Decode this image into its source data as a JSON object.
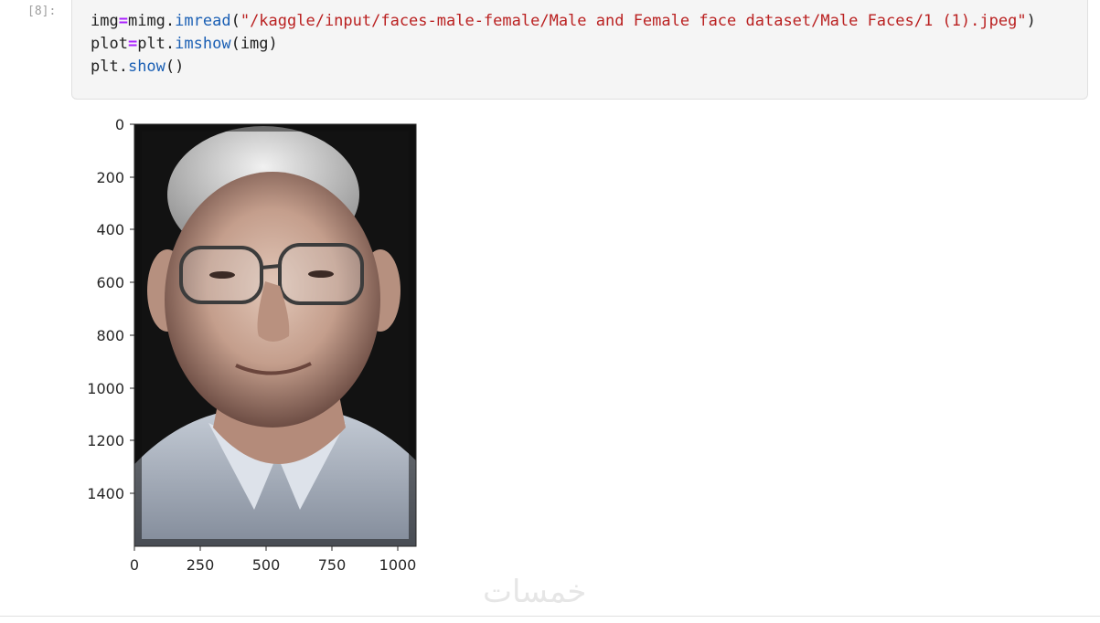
{
  "cell": {
    "prompt": "[8]:",
    "code": {
      "line1": {
        "var": "img",
        "op": "=",
        "obj": "mimg.",
        "fn": "imread",
        "open": "(",
        "str": "\"/kaggle/input/faces-male-female/Male and Female face dataset/Male Faces/1 (1).jpeg\"",
        "close": ")"
      },
      "line2": {
        "var": "plot",
        "op": "=",
        "obj": "plt.",
        "fn": "imshow",
        "args": "(img)"
      },
      "line3": {
        "obj": "plt.",
        "fn": "show",
        "args": "()"
      }
    }
  },
  "output": {
    "plot": {
      "x_ticks": [
        "0",
        "250",
        "500",
        "750",
        "1000"
      ],
      "y_ticks": [
        "0",
        "200",
        "400",
        "600",
        "800",
        "1000",
        "1200",
        "1400"
      ],
      "image_subject": "elderly-man-portrait"
    }
  },
  "chart_data": {
    "type": "image",
    "x_ticks": [
      0,
      250,
      500,
      750,
      1000
    ],
    "y_ticks": [
      0,
      200,
      400,
      600,
      800,
      1000,
      1200,
      1400
    ],
    "xlim": [
      0,
      1067
    ],
    "ylim": [
      1600,
      0
    ],
    "grid": false
  },
  "watermark": {
    "text": "خمسات"
  },
  "colors": {
    "code_bg": "#f5f5f5",
    "operator": "#aa22ff",
    "function": "#1a5fb4",
    "string": "#ba2121"
  }
}
